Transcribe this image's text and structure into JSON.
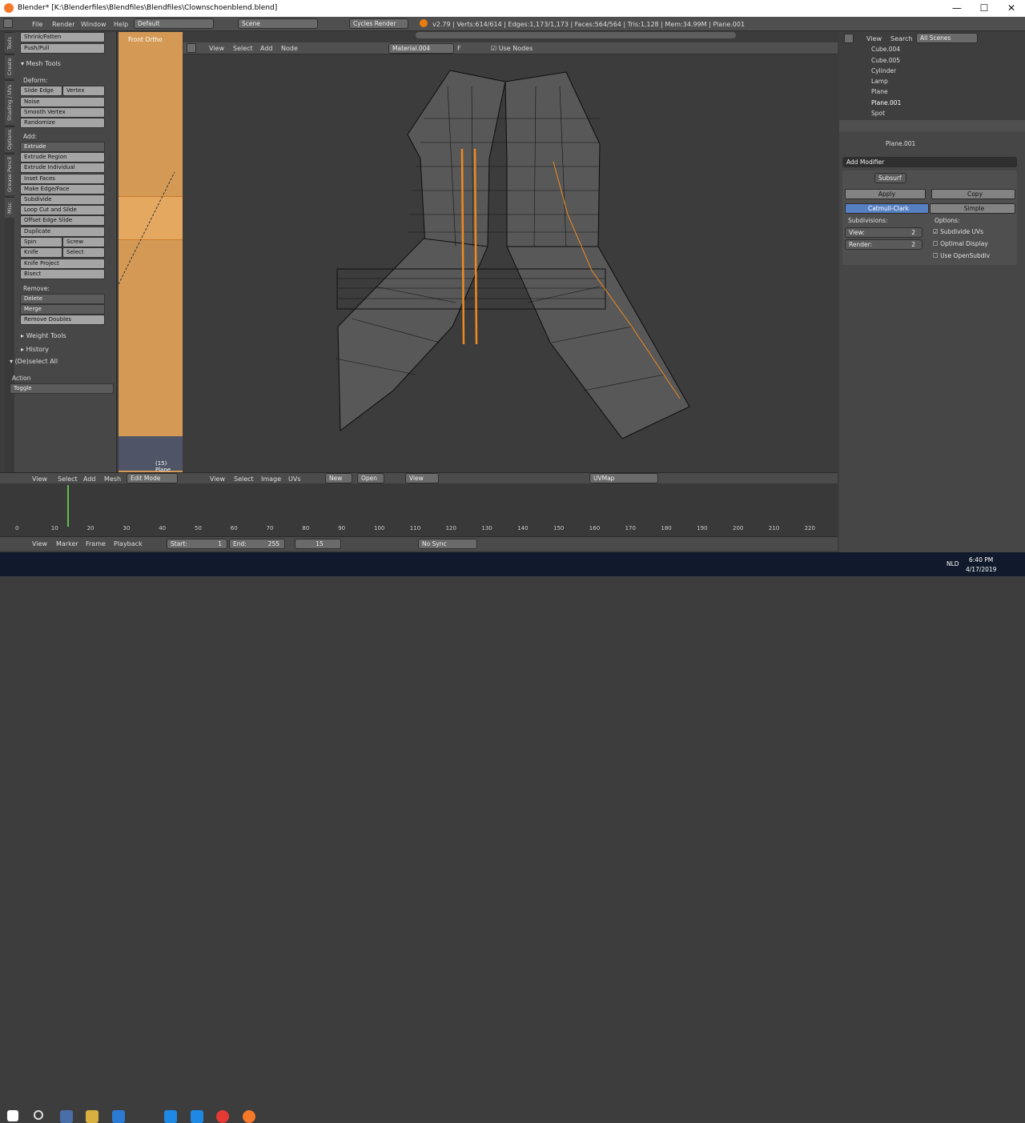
{
  "window": {
    "title": "Blender* [K:\\Blenderfiles\\Blendfiles\\Blendfiles\\Clownschoenblend.blend]",
    "minimize": "—",
    "maximize": "☐",
    "close": "✕"
  },
  "infobar": {
    "menus": [
      "File",
      "Render",
      "Window",
      "Help"
    ],
    "layout": "Default",
    "scene": "Scene",
    "engine": "Cycles Render",
    "stats": "v2.79 | Verts:614/614 | Edges:1,173/1,173 | Faces:564/564 | Tris:1,128 | Mem:34.99M | Plane.001"
  },
  "toolshelf": {
    "tabs": [
      "Tools",
      "Create",
      "Shading / UVs",
      "Options",
      "Grease Pencil",
      "Misc"
    ],
    "top_buttons": [
      "Shrink/Fatten",
      "Push/Pull"
    ],
    "section_mesh": "Mesh Tools",
    "deform_label": "Deform:",
    "deform": {
      "slide_edge": "Slide Edge",
      "vertex": "Vertex",
      "noise": "Noise",
      "smooth_vertex": "Smooth Vertex",
      "randomize": "Randomize"
    },
    "add_label": "Add:",
    "add": {
      "extrude": "Extrude",
      "extrude_region": "Extrude Region",
      "extrude_individual": "Extrude Individual",
      "inset_faces": "Inset Faces",
      "make_edge_face": "Make Edge/Face",
      "subdivide": "Subdivide",
      "loop_cut": "Loop Cut and Slide",
      "offset_edge": "Offset Edge Slide",
      "duplicate": "Duplicate",
      "spin": "Spin",
      "screw": "Screw",
      "knife": "Knife",
      "select": "Select",
      "knife_project": "Knife Project",
      "bisect": "Bisect"
    },
    "remove_label": "Remove:",
    "remove": {
      "delete": "Delete",
      "merge": "Merge",
      "remove_doubles": "Remove Doubles"
    },
    "weight_tools": "Weight Tools",
    "history": "History",
    "operator_title": "(De)select All",
    "action_label": "Action",
    "action_value": "Toggle"
  },
  "viewport_left": {
    "label": "Front Ortho",
    "object_label": "(15) Plane"
  },
  "node_editor": {
    "menus": [
      "View",
      "Select",
      "Add",
      "Node"
    ],
    "material": "Material.004",
    "fake_user": "F",
    "use_nodes": "Use Nodes",
    "panel_label": "Node"
  },
  "outliner": {
    "menus": [
      "View",
      "Search"
    ],
    "filter": "All Scenes",
    "items": [
      "Cube.004",
      "Cube.005",
      "Cylinder",
      "Lamp",
      "Plane",
      "Plane.001",
      "Spot"
    ]
  },
  "properties": {
    "breadcrumb": "Plane.001",
    "add_modifier": "Add Modifier",
    "modifier_name": "Subsurf",
    "apply": "Apply",
    "copy": "Copy",
    "catmull": "Catmull-Clark",
    "simple": "Simple",
    "subdivisions": "Subdivisions:",
    "options": "Options:",
    "view_label": "View:",
    "view_value": "2",
    "render_label": "Render:",
    "render_value": "2",
    "subdivide_uvs": "Subdivide UVs",
    "optimal_display": "Optimal Display",
    "use_opensubdiv": "Use OpenSubdiv",
    "subdivide_uvs_checked": true,
    "optimal_display_checked": false,
    "use_opensubdiv_checked": false
  },
  "bottom_3d": {
    "menus": [
      "View",
      "Select",
      "Add",
      "Mesh"
    ],
    "mode": "Edit Mode"
  },
  "uv_editor": {
    "menus": [
      "View",
      "Select",
      "Image",
      "UVs"
    ],
    "new": "New",
    "open": "Open",
    "view": "View",
    "uvmap": "UVMap"
  },
  "timeline": {
    "ticks": [
      "0",
      "10",
      "20",
      "30",
      "40",
      "50",
      "60",
      "70",
      "80",
      "90",
      "100",
      "110",
      "120",
      "130",
      "140",
      "150",
      "160",
      "170",
      "180",
      "190",
      "200",
      "210",
      "220"
    ],
    "current_frame": 15,
    "menus": [
      "View",
      "Marker",
      "Frame",
      "Playback"
    ],
    "start_label": "Start:",
    "start": "1",
    "end_label": "End:",
    "end": "255",
    "frame": "15",
    "sync": "No Sync"
  },
  "taskbar": {
    "lang": "NLD",
    "time": "6:40 PM",
    "date": "4/17/2019"
  }
}
